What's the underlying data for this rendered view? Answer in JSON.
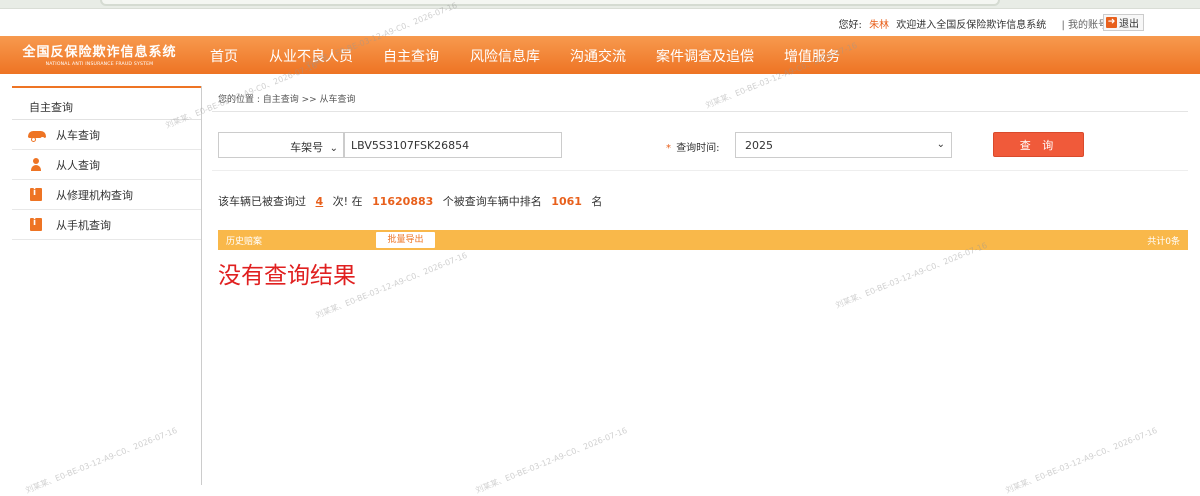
{
  "userbar": {
    "greeting": "您好:",
    "username": "朱林",
    "welcome": "欢迎进入全国反保险欺诈信息系统",
    "my_account": "| 我的账号",
    "logout": "退出"
  },
  "logo": {
    "title_cn": "全国反保险欺诈信息系统",
    "title_en": "NATIONAL ANTI INSURANCE FRAUD SYSTEM"
  },
  "nav": {
    "items": [
      "首页",
      "从业不良人员",
      "自主查询",
      "风险信息库",
      "沟通交流",
      "案件调查及追偿",
      "增值服务"
    ]
  },
  "sidebar": {
    "title": "自主查询",
    "items": [
      {
        "label": "从车查询",
        "icon": "car-icon"
      },
      {
        "label": "从人查询",
        "icon": "person-icon"
      },
      {
        "label": "从修理机构查询",
        "icon": "document-icon"
      },
      {
        "label": "从手机查询",
        "icon": "document-icon"
      }
    ]
  },
  "breadcrumb": "您的位置 : 自主查询 >> 从车查询",
  "form": {
    "type_value": "车架号",
    "vin_value": "LBV5S3107FSK26854",
    "time_label_star": "*",
    "time_label": "查询时间:",
    "year_value": "2025",
    "query_button": "查 询"
  },
  "stats": {
    "prefix": "该车辆已被查询过",
    "times": "4",
    "mid1": "次! 在",
    "total_vehicles": "11620883",
    "mid2": "个被查询车辆中排名",
    "rank": "1061",
    "suffix": "名"
  },
  "history": {
    "label": "历史赔案",
    "export_button": "批量导出",
    "total": "共计0条"
  },
  "no_result": "没有查询结果",
  "watermark": "刘某某、E0-BE-03-12-A9-C0、2026-07-16",
  "colors": {
    "nav_orange": "#ee7424",
    "history_bar": "#f9b84a",
    "query_button": "#f05a3a",
    "no_result": "#e02020"
  }
}
